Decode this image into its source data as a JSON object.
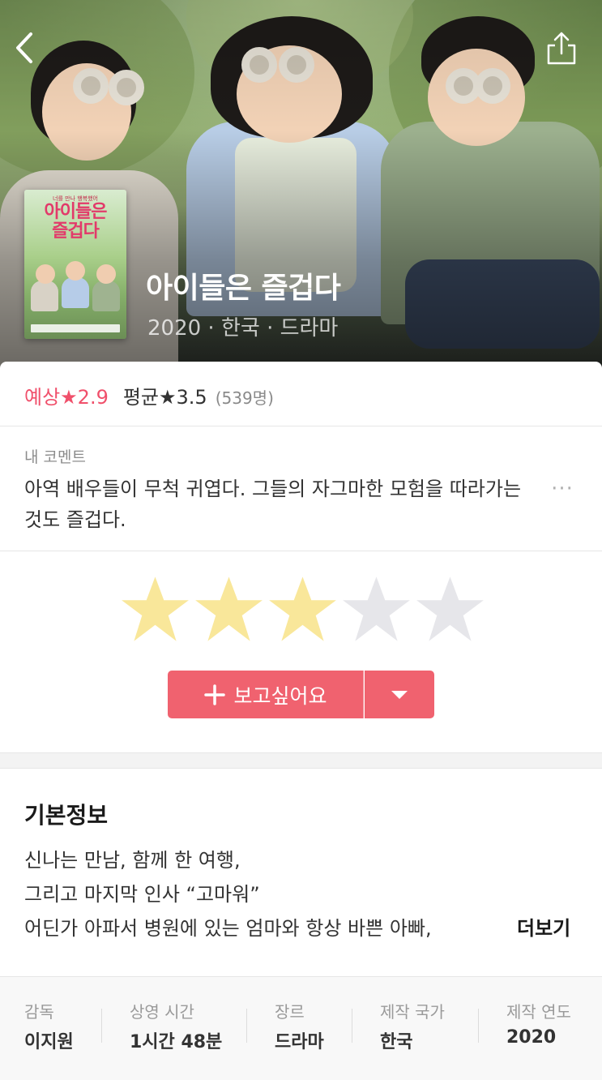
{
  "header": {
    "back_icon": "chevron-left-icon",
    "share_icon": "share-icon"
  },
  "poster": {
    "top_text": "너를 만나 행복했어",
    "title": "아이들은 즐겁다"
  },
  "movie": {
    "title": "아이들은 즐겁다",
    "subtitle": "2020 · 한국 · 드라마"
  },
  "rating": {
    "predicted": "예상★2.9",
    "average": "평균★3.5",
    "count": "(539명)"
  },
  "my_comment": {
    "label": "내 코멘트",
    "text": "아역 배우들이 무척 귀엽다. 그들의 자그마한 모험을 따라가는 것도 즐겁다.",
    "more": "···"
  },
  "user_rating": {
    "value": 3,
    "max": 5,
    "filled_color": "#f9e79a",
    "empty_color": "#e6e6ea"
  },
  "wish": {
    "label": "보고싶어요",
    "plus_icon": "plus-icon",
    "dropdown_icon": "caret-down-icon",
    "color": "#f0626f"
  },
  "basic_info": {
    "title": "기본정보",
    "lines": [
      "신나는 만남, 함께 한 여행,",
      "그리고 마지막 인사 “고마워”",
      "어딘가 아파서 병원에 있는 엄마와 항상 바쁜 아빠,"
    ],
    "more": "더보기"
  },
  "meta": [
    {
      "key": "감독",
      "value": "이지원"
    },
    {
      "key": "상영 시간",
      "value": "1시간 48분"
    },
    {
      "key": "장르",
      "value": "드라마"
    },
    {
      "key": "제작 국가",
      "value": "한국"
    },
    {
      "key": "제작 연도",
      "value": "2020"
    }
  ],
  "accent_color": "#f0506b"
}
